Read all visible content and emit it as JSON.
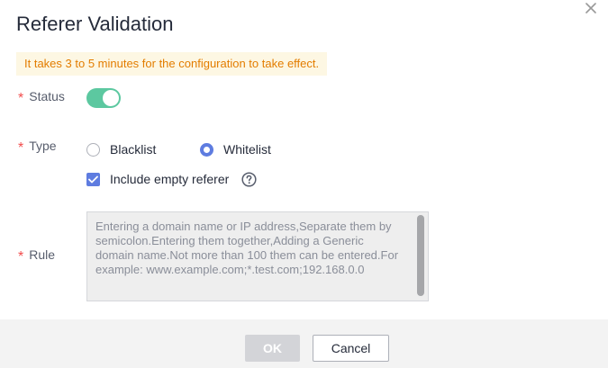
{
  "dialog": {
    "title": "Referer Validation",
    "close_icon": "close-icon",
    "notice": "It takes 3 to 5 minutes for the configuration to take effect."
  },
  "form": {
    "status": {
      "label": "Status",
      "required_mark": "*",
      "enabled": true
    },
    "type": {
      "label": "Type",
      "required_mark": "*",
      "options": [
        "Blacklist",
        "Whitelist"
      ],
      "selected": "Whitelist"
    },
    "include_empty": {
      "label": "Include empty referer",
      "checked": true,
      "help_icon": "question-circle-icon"
    },
    "rule": {
      "label": "Rule",
      "required_mark": "*",
      "placeholder": "Entering a domain name or IP address,Separate them by semicolon.Entering them together,Adding a Generic domain name.Not more than 100 them can be entered.For example: www.example.com;*.test.com;192.168.0.0"
    }
  },
  "footer": {
    "ok_label": "OK",
    "cancel_label": "Cancel"
  },
  "colors": {
    "accent": "#5e7ce0",
    "toggle_on": "#5cc8a0",
    "notice_text": "#e37d00",
    "notice_bg": "#fdf7e3",
    "required": "#f24d4d"
  }
}
